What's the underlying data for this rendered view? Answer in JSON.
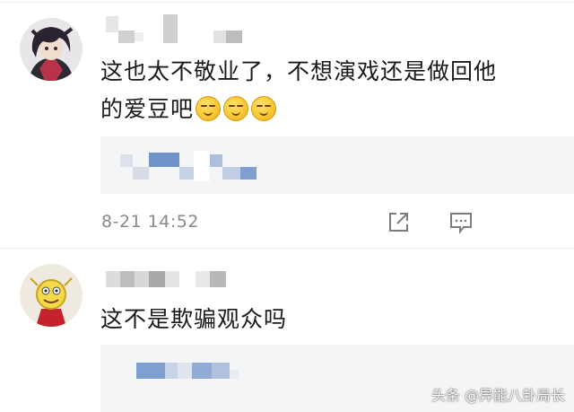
{
  "comments": [
    {
      "text": "这也太不敬业了，不想演戏还是做回他",
      "text_line2": "的爱豆吧",
      "emoji_icons": [
        "smirk-emoji-icon",
        "smirk-emoji-icon",
        "smirk-emoji-icon"
      ],
      "timestamp": "8-21 14:52",
      "actions": [
        "share-icon",
        "comment-icon"
      ]
    },
    {
      "text": "这不是欺骗观众吗"
    }
  ],
  "watermark": "头条 @异能八卦局长",
  "colors": {
    "text": "#1a1a1a",
    "meta": "#8a8a8a",
    "reply_bg": "#f4f5f7",
    "divider": "#ececec"
  }
}
